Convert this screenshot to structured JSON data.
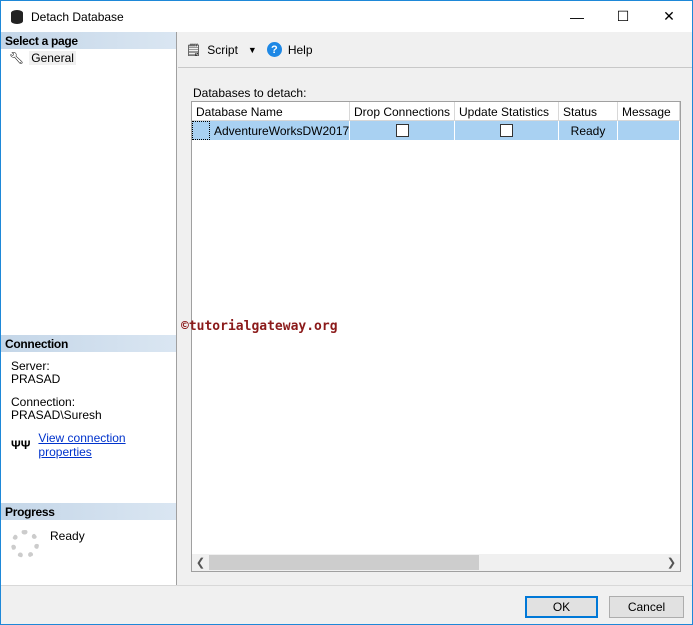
{
  "window": {
    "title": "Detach Database",
    "minimize": "—",
    "maximize": "☐",
    "close": "✕"
  },
  "sidebar": {
    "select_page": "Select a page",
    "pages": [
      {
        "label": "General"
      }
    ],
    "connection": {
      "heading": "Connection",
      "server_label": "Server:",
      "server": "PRASAD",
      "connection_label": "Connection:",
      "connection": "PRASAD\\Suresh",
      "link": "View connection properties"
    },
    "progress": {
      "heading": "Progress",
      "status": "Ready"
    }
  },
  "toolbar": {
    "script": "Script",
    "help": "Help",
    "help_glyph": "?"
  },
  "main": {
    "label": "Databases to detach:",
    "columns": [
      "Database Name",
      "Drop Connections",
      "Update Statistics",
      "Status",
      "Message"
    ],
    "rows": [
      {
        "database_name": "AdventureWorksDW2017",
        "drop_connections": false,
        "update_statistics": false,
        "status": "Ready",
        "message": ""
      }
    ]
  },
  "watermark": "©tutorialgateway.org",
  "footer": {
    "ok": "OK",
    "cancel": "Cancel"
  }
}
